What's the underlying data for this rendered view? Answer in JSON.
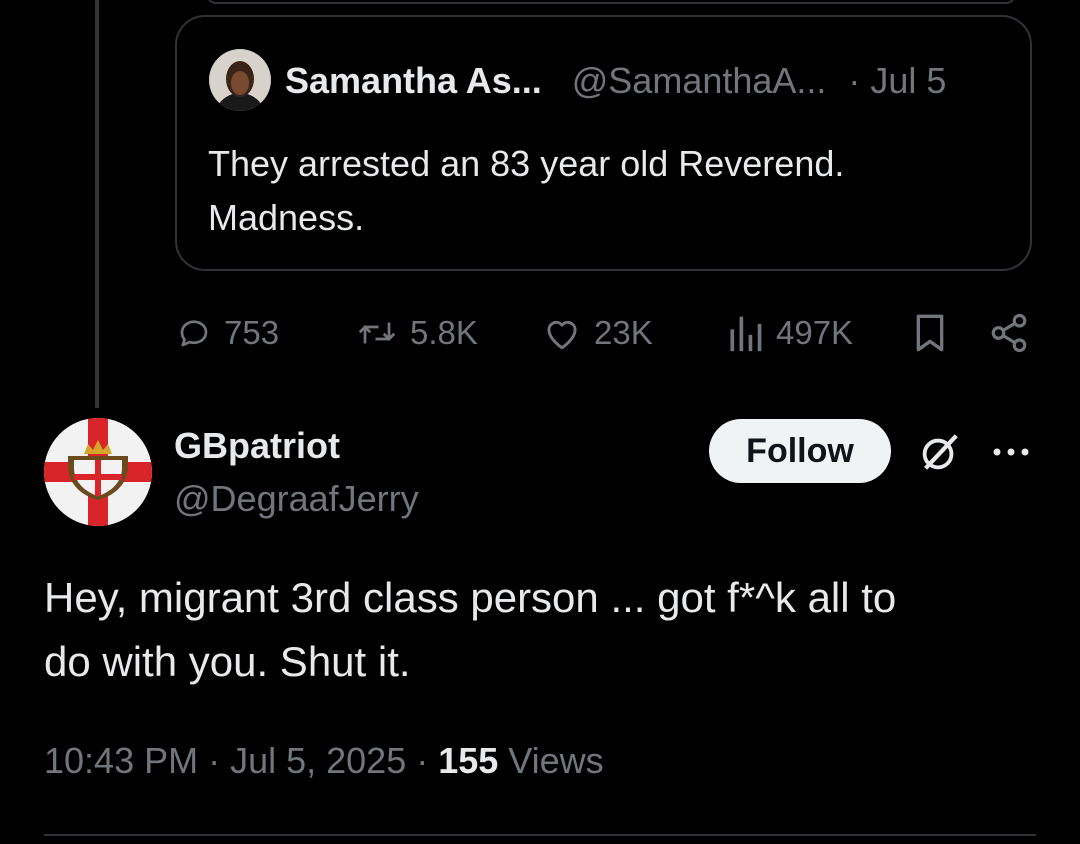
{
  "quoted_tweet": {
    "author_name": "Samantha As...",
    "author_handle": "@SamanthaA...",
    "date": "· Jul 5",
    "text_line1": "They arrested an 83 year old Reverend.",
    "text_line2": "Madness."
  },
  "actions": {
    "replies": "753",
    "reposts": "5.8K",
    "likes": "23K",
    "views": "497K"
  },
  "tweet": {
    "author_name": "GBpatriot",
    "author_handle": "@DegraafJerry",
    "follow_label": "Follow",
    "text_line1": "Hey, migrant 3rd class person ... got f*^k all to",
    "text_line2": "do with you. Shut it.",
    "time": "10:43 PM · Jul 5, 2025 · ",
    "views_count": "155",
    "views_label": " Views"
  },
  "colors": {
    "background": "#000000",
    "primary_text": "#e7e9ea",
    "secondary_text": "#71767b",
    "border": "#2f3336",
    "follow_bg": "#eff3f4"
  },
  "icons": [
    "reply-icon",
    "repost-icon",
    "like-icon",
    "views-icon",
    "bookmark-icon",
    "share-icon",
    "grok-icon",
    "more-icon"
  ]
}
